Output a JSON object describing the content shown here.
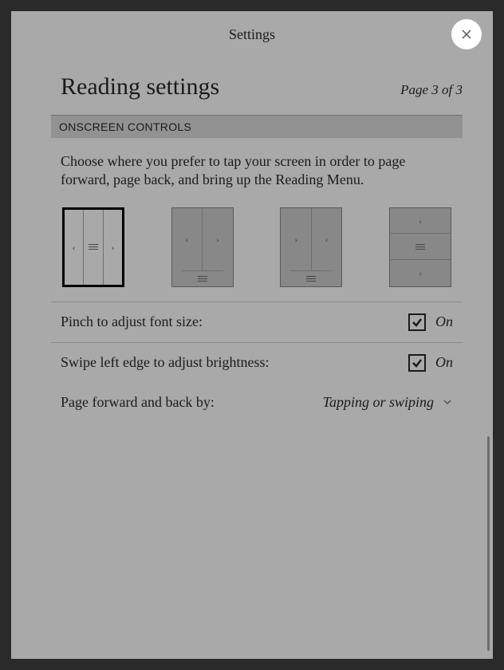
{
  "header": {
    "title": "Settings"
  },
  "page": {
    "title": "Reading settings",
    "indicator": "Page 3 of 3"
  },
  "section_header": "ONSCREEN CONTROLS",
  "instruction": "Choose where you prefer to tap your screen in order to page forward, page back, and bring up the Reading Menu.",
  "settings": {
    "pinch": {
      "label": "Pinch to adjust font size:",
      "state": "On"
    },
    "swipe": {
      "label": "Swipe left edge to adjust brightness:",
      "state": "On"
    },
    "pageforward": {
      "label": "Page forward and back by:",
      "value": "Tapping or swiping"
    }
  }
}
